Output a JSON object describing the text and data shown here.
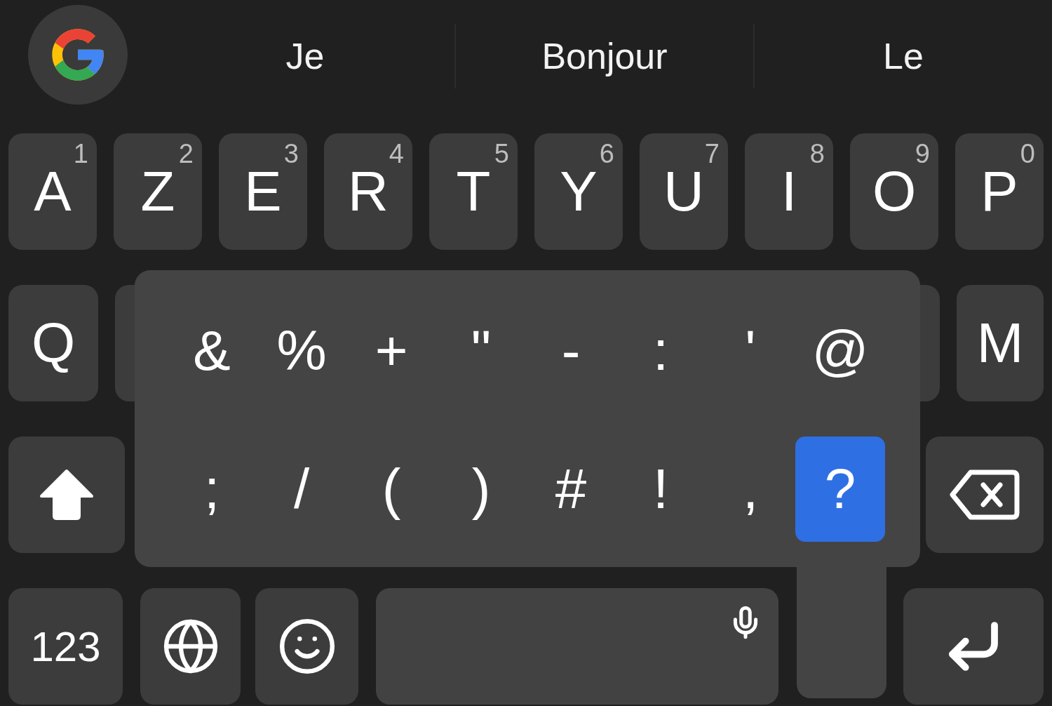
{
  "suggestions": [
    "Je",
    "Bonjour",
    "Le"
  ],
  "top_row": [
    {
      "letter": "A",
      "hint": "1"
    },
    {
      "letter": "Z",
      "hint": "2"
    },
    {
      "letter": "E",
      "hint": "3"
    },
    {
      "letter": "R",
      "hint": "4"
    },
    {
      "letter": "T",
      "hint": "5"
    },
    {
      "letter": "Y",
      "hint": "6"
    },
    {
      "letter": "U",
      "hint": "7"
    },
    {
      "letter": "I",
      "hint": "8"
    },
    {
      "letter": "O",
      "hint": "9"
    },
    {
      "letter": "P",
      "hint": "0"
    }
  ],
  "home_row": {
    "first": "Q",
    "last": "M"
  },
  "numbers_key": "123",
  "popup": {
    "rows": [
      [
        {
          "symbol": "&",
          "selected": false
        },
        {
          "symbol": "%",
          "selected": false
        },
        {
          "symbol": "+",
          "selected": false
        },
        {
          "symbol": "\"",
          "selected": false
        },
        {
          "symbol": "-",
          "selected": false
        },
        {
          "symbol": ":",
          "selected": false
        },
        {
          "symbol": "'",
          "selected": false
        },
        {
          "symbol": "@",
          "selected": false
        }
      ],
      [
        {
          "symbol": ";",
          "selected": false
        },
        {
          "symbol": "/",
          "selected": false
        },
        {
          "symbol": "(",
          "selected": false
        },
        {
          "symbol": ")",
          "selected": false
        },
        {
          "symbol": "#",
          "selected": false
        },
        {
          "symbol": "!",
          "selected": false
        },
        {
          "symbol": ",",
          "selected": false
        },
        {
          "symbol": "?",
          "selected": true
        }
      ]
    ]
  }
}
